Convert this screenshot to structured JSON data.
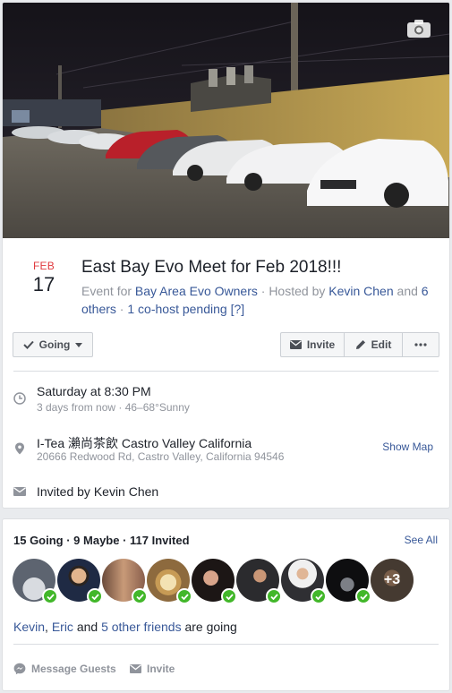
{
  "event": {
    "cover_icon": "camera-icon",
    "date": {
      "month": "FEB",
      "day": "17"
    },
    "title": "East Bay Evo Meet for Feb 2018!!!",
    "meta": {
      "prefix": "Event for ",
      "page": "Bay Area Evo Owners",
      "sep1": " · Hosted by ",
      "host": "Kevin Chen",
      "and": " and ",
      "others": "6 others",
      "sep2": " · ",
      "cohost": "1 co-host pending [?]"
    },
    "actions": {
      "going": "Going",
      "invite": "Invite",
      "edit": "Edit"
    },
    "time": {
      "main": "Saturday at 8:30 PM",
      "sub": "3 days from now · 46–68°Sunny"
    },
    "location": {
      "main": "I-Tea 瀨尚茶飲 Castro Valley California",
      "sub": "20666 Redwood Rd, Castro Valley, California 94546",
      "map_link": "Show Map"
    },
    "invited_by": "Invited by Kevin Chen"
  },
  "guests": {
    "counts": "15 Going · 9 Maybe · 117 Invited",
    "see_all": "See All",
    "more_count": "+3",
    "friends": {
      "a": "Kevin",
      "comma": ", ",
      "b": "Eric",
      "and": " and ",
      "others": "5 other friends",
      "suffix": " are going"
    },
    "message_guests": "Message Guests",
    "invite": "Invite"
  },
  "colors": {
    "link": "#385898",
    "date_red": "#e0393e",
    "going_green": "#42b72a"
  }
}
